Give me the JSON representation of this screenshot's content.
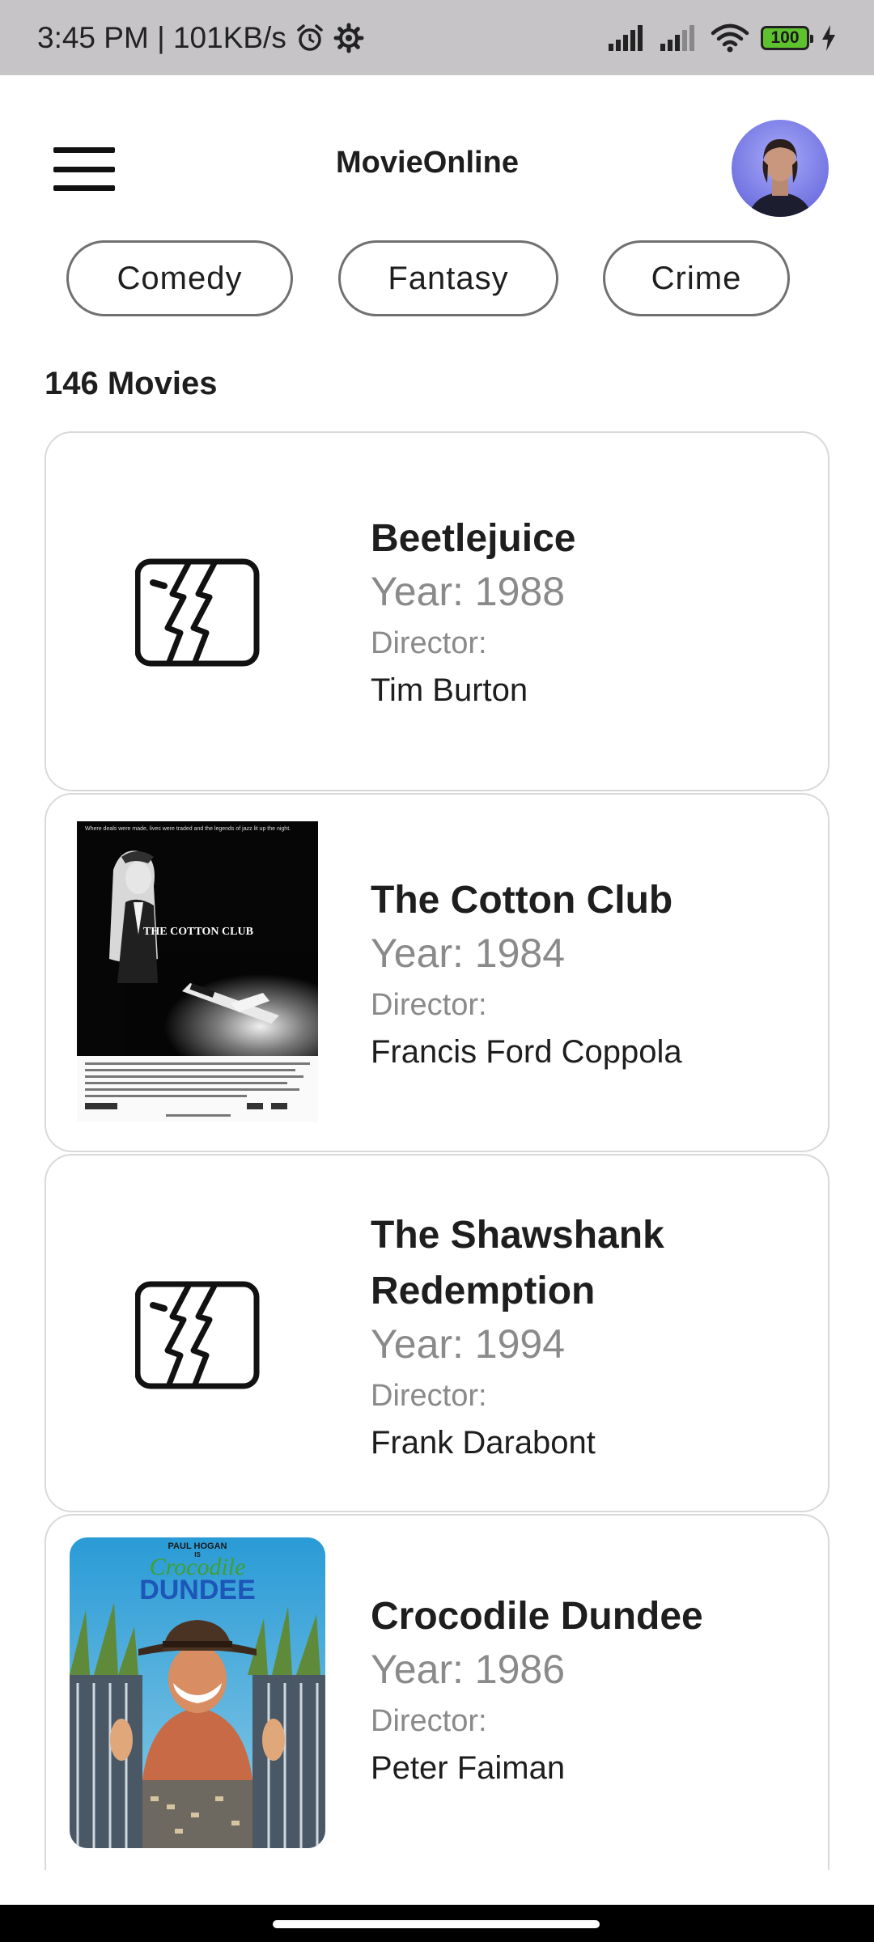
{
  "status_bar": {
    "time_speed": "3:45 PM | 101KB/s",
    "battery": "100",
    "icons": [
      "alarm-icon",
      "settings-gear-icon",
      "signal-icon",
      "signal-icon",
      "wifi-icon",
      "battery-icon",
      "charging-icon"
    ]
  },
  "header": {
    "title": "MovieOnline",
    "menu_icon": "hamburger-menu-icon",
    "avatar": "user-avatar"
  },
  "genres": [
    "Comedy",
    "Fantasy",
    "Crime"
  ],
  "movie_count": "146 Movies",
  "movies": [
    {
      "title": "Beetlejuice",
      "year": "Year: 1988",
      "director_label": "Director:",
      "director": "Tim Burton",
      "poster": "placeholder-image-icon"
    },
    {
      "title": "The Cotton Club",
      "year": "Year: 1984",
      "director_label": "Director:",
      "director": "Francis Ford Coppola",
      "poster": "movie-poster"
    },
    {
      "title": "The Shawshank Redemption",
      "year": "Year: 1994",
      "director_label": "Director:",
      "director": "Frank Darabont",
      "poster": "placeholder-image-icon"
    },
    {
      "title": "Crocodile Dundee",
      "year": "Year: 1986",
      "director_label": "Director:",
      "director": "Peter Faiman",
      "poster": "movie-poster"
    }
  ],
  "poster_text": {
    "cotton_club_tagline": "Where deals were made, lives were traded and the legends of jazz lit up the night.",
    "cotton_club_logo": "THE COTTON CLUB",
    "crocodile_actor": "PAUL HOGAN",
    "crocodile_is": "IS",
    "crocodile_logo_top": "Crocodile",
    "crocodile_logo_bottom": "DUNDEE"
  },
  "colors": {
    "status_bar_bg": "#c6c4c7",
    "chip_border": "#707070",
    "card_border": "#d9d9d9",
    "secondary_text": "#8a8a8a",
    "battery_fill": "#5ec22f"
  }
}
